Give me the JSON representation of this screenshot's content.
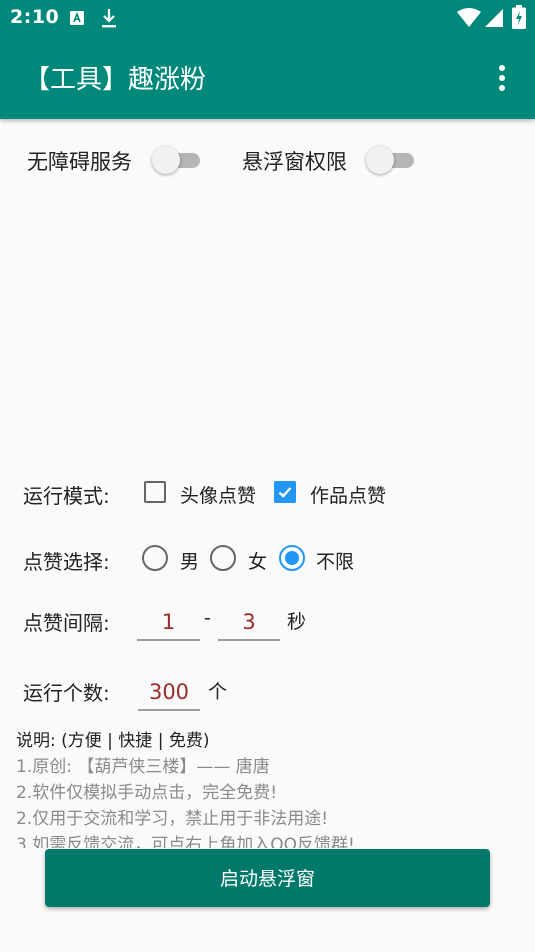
{
  "status_bar": {
    "time": "2:10",
    "icons": [
      "text-a-icon",
      "download-icon",
      "wifi-icon",
      "signal-icon",
      "battery-icon"
    ]
  },
  "app_bar": {
    "title": "【工具】趣涨粉",
    "menu_icon": "more-vertical-icon"
  },
  "switches": {
    "accessibility": {
      "label": "无障碍服务",
      "on": false
    },
    "overlay": {
      "label": "悬浮窗权限",
      "on": false
    }
  },
  "run_mode": {
    "label": "运行模式:",
    "options": [
      {
        "label": "头像点赞",
        "checked": false
      },
      {
        "label": "作品点赞",
        "checked": true
      }
    ]
  },
  "like_choice": {
    "label": "点赞选择:",
    "options": [
      {
        "label": "男",
        "selected": false
      },
      {
        "label": "女",
        "selected": false
      },
      {
        "label": "不限",
        "selected": true
      }
    ]
  },
  "interval": {
    "label": "点赞间隔:",
    "min": "1",
    "separator": "-",
    "max": "3",
    "unit": "秒"
  },
  "count": {
    "label": "运行个数:",
    "value": "300",
    "unit": "个"
  },
  "notes": {
    "title": "说明: (方便 | 快捷 | 免费)",
    "lines": [
      "1.原创: 【葫芦侠三楼】—— 唐唐",
      "2.软件仅模拟手动点击，完全免费!",
      "2.仅用于交流和学习，禁止用于非法用途!",
      "3.如需反馈交流，可点右上角加入QQ反馈群!"
    ]
  },
  "start_button": {
    "label": "启动悬浮窗"
  },
  "colors": {
    "primary": "#00897b",
    "button": "#00796b",
    "accent": "#2196f3",
    "input_text": "#9c2b2b"
  }
}
